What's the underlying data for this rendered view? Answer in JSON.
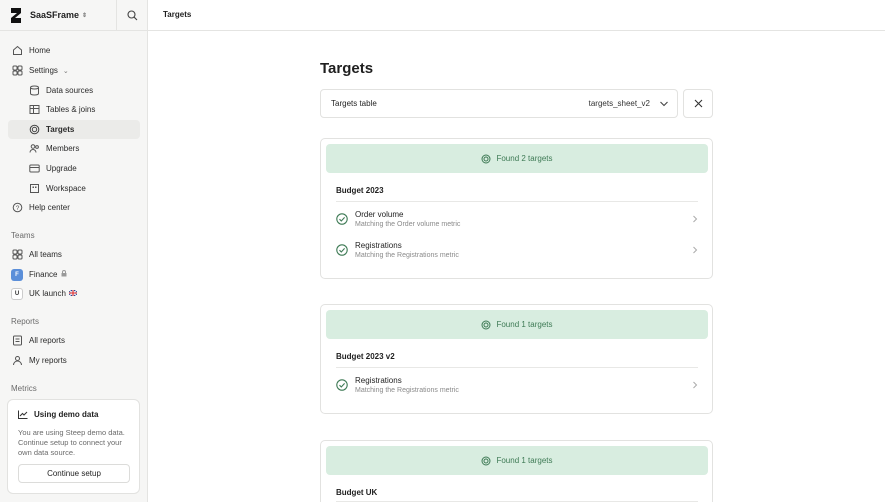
{
  "app": {
    "brand": "SaaSFrame"
  },
  "header": {
    "breadcrumb": "Targets"
  },
  "sidebar": {
    "home": "Home",
    "settings": "Settings",
    "sub": {
      "data_sources": "Data sources",
      "tables_joins": "Tables & joins",
      "targets": "Targets",
      "members": "Members",
      "upgrade": "Upgrade",
      "workspace": "Workspace"
    },
    "help": "Help center",
    "teams_label": "Teams",
    "all_teams": "All teams",
    "finance": {
      "badge": "F",
      "label": "Finance"
    },
    "uk": {
      "badge": "U",
      "label": "UK launch"
    },
    "reports_label": "Reports",
    "all_reports": "All reports",
    "my_reports": "My reports",
    "metrics_label": "Metrics"
  },
  "demo": {
    "title": "Using demo data",
    "text": "You are using Steep demo data. Continue setup to connect your own data source.",
    "button": "Continue setup"
  },
  "main": {
    "title": "Targets",
    "table_label": "Targets table",
    "table_value": "targets_sheet_v2",
    "cards": [
      {
        "banner": "Found 2 targets",
        "group": "Budget 2023",
        "rows": [
          {
            "name": "Order volume",
            "sub": "Matching the Order volume metric"
          },
          {
            "name": "Registrations",
            "sub": "Matching the Registrations metric"
          }
        ]
      },
      {
        "banner": "Found 1 targets",
        "group": "Budget 2023 v2",
        "rows": [
          {
            "name": "Registrations",
            "sub": "Matching the Registrations metric"
          }
        ]
      },
      {
        "banner": "Found 1 targets",
        "group": "Budget UK",
        "rows": []
      }
    ]
  },
  "colors": {
    "banner_bg": "#d8ede0",
    "banner_text": "#3e7a55",
    "check": "#3e7a55",
    "selected": "#ebebe9"
  }
}
